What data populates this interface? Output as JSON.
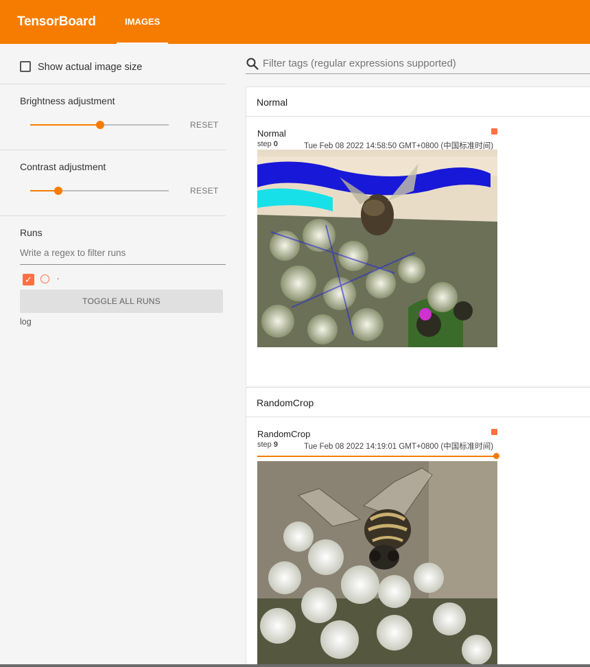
{
  "header": {
    "brand": "TensorBoard",
    "tab_label": "IMAGES",
    "background_color": "#f57c00"
  },
  "sidebar": {
    "show_actual_size_label": "Show actual image size",
    "brightness": {
      "label": "Brightness adjustment",
      "reset_label": "RESET",
      "value_fraction": 0.5
    },
    "contrast": {
      "label": "Contrast adjustment",
      "reset_label": "RESET",
      "value_fraction": 0.2
    },
    "runs": {
      "title": "Runs",
      "filter_placeholder": "Write a regex to filter runs",
      "run_name": ".",
      "run_color": "#ff7043",
      "toggle_all_label": "TOGGLE ALL RUNS",
      "log_label": "log"
    }
  },
  "main": {
    "search_placeholder": "Filter tags (regular expressions supported)",
    "groups": [
      {
        "name": "Normal",
        "card": {
          "tag": "Normal",
          "step_label": "step",
          "step_value": "0",
          "timestamp": "Tue Feb 08 2022 14:58:50 GMT+0800 (中国标准时间)"
        }
      },
      {
        "name": "RandomCrop",
        "card": {
          "tag": "RandomCrop",
          "step_label": "step",
          "step_value": "9",
          "timestamp": "Tue Feb 08 2022 14:19:01 GMT+0800 (中国标准时间)",
          "step_slider_fraction": 1.0
        }
      }
    ]
  },
  "icons": {
    "search": "search-icon",
    "checkmark": "check-icon"
  }
}
